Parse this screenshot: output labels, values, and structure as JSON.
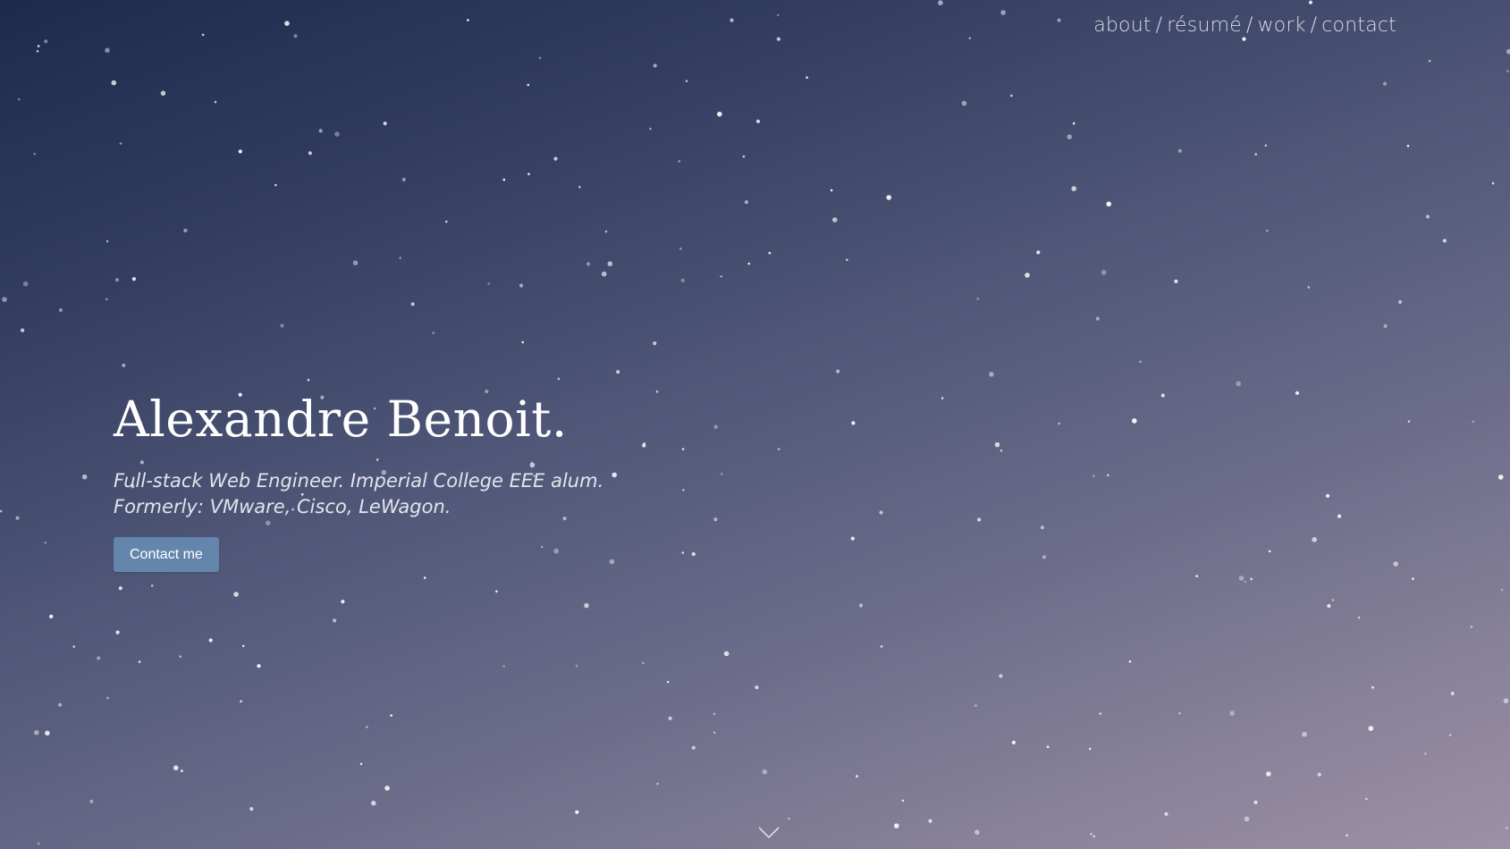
{
  "nav": {
    "items": [
      {
        "label": "about"
      },
      {
        "label": "résumé"
      },
      {
        "label": "work"
      },
      {
        "label": "contact"
      }
    ],
    "separator": "/"
  },
  "hero": {
    "name": "Alexandre Benoit.",
    "tagline_line1": "Full-stack Web Engineer. Imperial College EEE alum.",
    "tagline_line2": "Formerly: VMware, Cisco, LeWagon.",
    "cta_label": "Contact me"
  },
  "scroll_indicator": {
    "icon": "chevron-down-icon"
  },
  "colors": {
    "background_top": "#1c2b4c",
    "background_bottom": "#9d90a8",
    "button": "#6486ad",
    "text": "#ffffff"
  }
}
